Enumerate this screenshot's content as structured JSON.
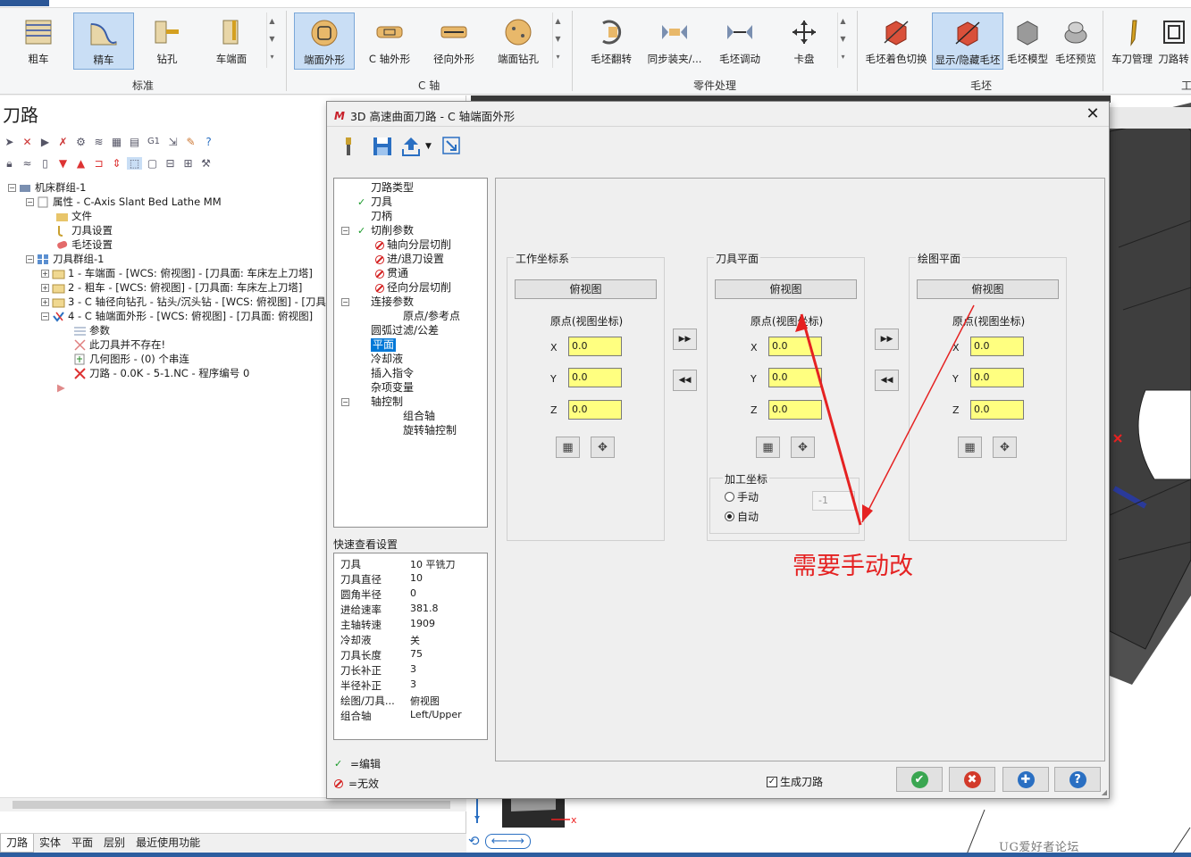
{
  "ribbon": {
    "groups": [
      {
        "label": "标准",
        "buttons": [
          "粗车",
          "精车",
          "钻孔",
          "车端面"
        ],
        "active": 1
      },
      {
        "label": "C 轴",
        "buttons": [
          "端面外形",
          "C 轴外形",
          "径向外形",
          "端面钻孔"
        ],
        "active": 0
      },
      {
        "label": "零件处理",
        "buttons": [
          "毛坯翻转",
          "同步装夹/...",
          "毛坯调动",
          "卡盘"
        ]
      },
      {
        "label": "毛坯",
        "buttons": [
          "毛坯着色切换",
          "显示/隐藏毛坯",
          "毛坯模型",
          "毛坯预览"
        ],
        "active": 1
      },
      {
        "label": "工",
        "buttons": [
          "车刀管理",
          "刀路转"
        ]
      }
    ]
  },
  "left_panel": {
    "title": "刀路",
    "tree": [
      {
        "label": "机床群组-1"
      },
      {
        "label": "属性 - C-Axis Slant Bed Lathe MM"
      },
      {
        "label": "文件"
      },
      {
        "label": "刀具设置"
      },
      {
        "label": "毛坯设置"
      },
      {
        "label": "刀具群组-1"
      },
      {
        "label": "1 - 车端面 - [WCS: 俯视图] - [刀具面: 车床左上刀塔]"
      },
      {
        "label": "2 - 粗车 - [WCS: 俯视图] - [刀具面: 车床左上刀塔]"
      },
      {
        "label": "3 - C 轴径向钻孔 - 钻头/沉头钻 - [WCS: 俯视图] - [刀具"
      },
      {
        "label": "4 - C 轴端面外形 - [WCS: 俯视图] - [刀具面: 俯视图]"
      },
      {
        "label": "参数"
      },
      {
        "label": "此刀具并不存在!"
      },
      {
        "label": "几何图形 - (0) 个串连"
      },
      {
        "label": "刀路 - 0.0K - 5-1.NC - 程序编号 0"
      }
    ],
    "bottom_tabs": [
      "刀路",
      "实体",
      "平面",
      "层别",
      "最近使用功能"
    ],
    "toolbar_text": "G1"
  },
  "dialog": {
    "title": "3D 高速曲面刀路 - C 轴端面外形",
    "close": "✕",
    "nav": [
      {
        "label": "刀路类型",
        "state": "none",
        "indent": 0
      },
      {
        "label": "刀具",
        "state": "edit",
        "indent": 0
      },
      {
        "label": "刀柄",
        "state": "none",
        "indent": 0
      },
      {
        "label": "切削参数",
        "state": "edit",
        "indent": 0,
        "expander": true
      },
      {
        "label": "轴向分层切削",
        "state": "invalid",
        "indent": 1
      },
      {
        "label": "进/退刀设置",
        "state": "invalid",
        "indent": 1
      },
      {
        "label": "贯通",
        "state": "invalid",
        "indent": 1
      },
      {
        "label": "径向分层切削",
        "state": "invalid",
        "indent": 1
      },
      {
        "label": "连接参数",
        "state": "none",
        "indent": 0,
        "expander": true
      },
      {
        "label": "原点/参考点",
        "state": "none",
        "indent": 1
      },
      {
        "label": "圆弧过滤/公差",
        "state": "none",
        "indent": 0
      },
      {
        "label": "平面",
        "state": "none",
        "indent": 0,
        "selected": true
      },
      {
        "label": "冷却液",
        "state": "none",
        "indent": 0
      },
      {
        "label": "插入指令",
        "state": "none",
        "indent": 0
      },
      {
        "label": "杂项变量",
        "state": "none",
        "indent": 0
      },
      {
        "label": "轴控制",
        "state": "none",
        "indent": 0,
        "expander": true
      },
      {
        "label": "组合轴",
        "state": "none",
        "indent": 1
      },
      {
        "label": "旋转轴控制",
        "state": "none",
        "indent": 1
      }
    ],
    "quick_view": {
      "label": "快速查看设置",
      "rows": [
        {
          "k": "刀具",
          "v": "10 平铣刀"
        },
        {
          "k": "刀具直径",
          "v": "10"
        },
        {
          "k": "圆角半径",
          "v": "0"
        },
        {
          "k": "进给速率",
          "v": "381.8"
        },
        {
          "k": "主轴转速",
          "v": "1909"
        },
        {
          "k": "冷却液",
          "v": "关"
        },
        {
          "k": "刀具长度",
          "v": "75"
        },
        {
          "k": "刀长补正",
          "v": "3"
        },
        {
          "k": "半径补正",
          "v": "3"
        },
        {
          "k": "绘图/刀具...",
          "v": "俯视图"
        },
        {
          "k": "组合轴",
          "v": "Left/Upper"
        }
      ]
    },
    "legend": {
      "edit": "=编辑",
      "invalid": "=无效"
    },
    "planes": [
      {
        "title": "工作坐标系",
        "view": "俯视图",
        "origin_label": "原点(视图坐标)",
        "x": "0.0",
        "y": "0.0",
        "z": "0.0"
      },
      {
        "title": "刀具平面",
        "view": "俯视图",
        "origin_label": "原点(视图坐标)",
        "x": "0.0",
        "y": "0.0",
        "z": "0.0"
      },
      {
        "title": "绘图平面",
        "view": "俯视图",
        "origin_label": "原点(视图坐标)",
        "x": "0.0",
        "y": "0.0",
        "z": "0.0"
      }
    ],
    "axis_labels": {
      "x": "X",
      "y": "Y",
      "z": "Z"
    },
    "machine_coord": {
      "title": "加工坐标",
      "manual": "手动",
      "auto": "自动",
      "manual_value": "-1",
      "selected": "auto"
    },
    "generate_toolpath": {
      "label": "生成刀路",
      "checked": true
    },
    "buttons": [
      {
        "name": "ok",
        "color": "#3aa651",
        "glyph": "✔"
      },
      {
        "name": "cancel",
        "color": "#d23a2a",
        "glyph": "✖"
      },
      {
        "name": "add",
        "color": "#2a6fc2",
        "glyph": "✚"
      },
      {
        "name": "help",
        "color": "#2a6fc2",
        "glyph": "?"
      }
    ]
  },
  "annotation": {
    "text": "需要手动改",
    "color": "#e52222"
  },
  "watermark": "UG爱好者论坛 WWW.UGSNX.COM"
}
